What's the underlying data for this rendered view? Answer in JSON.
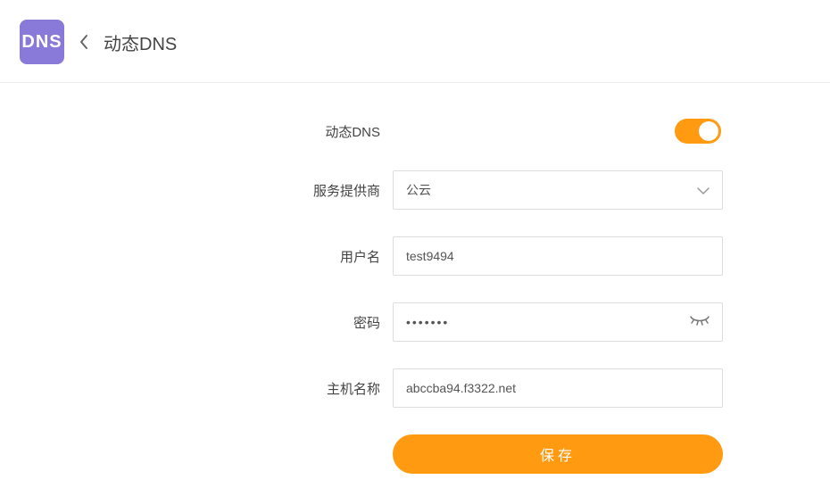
{
  "header": {
    "icon_text": "DNS",
    "title": "动态DNS"
  },
  "form": {
    "ddns_label": "动态DNS",
    "ddns_enabled": true,
    "provider_label": "服务提供商",
    "provider_value": "公云",
    "username_label": "用户名",
    "username_value": "test9494",
    "password_label": "密码",
    "password_masked": "•••••••",
    "hostname_label": "主机名称",
    "hostname_value": "abccba94.f3322.net",
    "save_label": "保存"
  }
}
